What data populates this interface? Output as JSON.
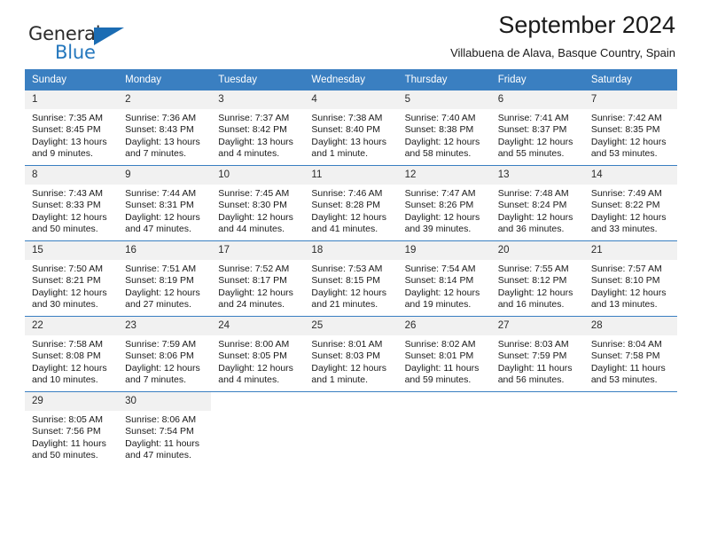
{
  "brand": {
    "name_part1": "General",
    "name_part2": "Blue",
    "triangle_color": "#1b6cb3",
    "blue_text_color": "#2477bd"
  },
  "header": {
    "month_title": "September 2024",
    "location": "Villabuena de Alava, Basque Country, Spain"
  },
  "calendar": {
    "header_bg": "#3a7fc1",
    "daynum_bg": "#f1f1f1",
    "weekdays": [
      "Sunday",
      "Monday",
      "Tuesday",
      "Wednesday",
      "Thursday",
      "Friday",
      "Saturday"
    ],
    "weeks": [
      [
        {
          "day": "1",
          "sunrise": "Sunrise: 7:35 AM",
          "sunset": "Sunset: 8:45 PM",
          "daylight": "Daylight: 13 hours and 9 minutes."
        },
        {
          "day": "2",
          "sunrise": "Sunrise: 7:36 AM",
          "sunset": "Sunset: 8:43 PM",
          "daylight": "Daylight: 13 hours and 7 minutes."
        },
        {
          "day": "3",
          "sunrise": "Sunrise: 7:37 AM",
          "sunset": "Sunset: 8:42 PM",
          "daylight": "Daylight: 13 hours and 4 minutes."
        },
        {
          "day": "4",
          "sunrise": "Sunrise: 7:38 AM",
          "sunset": "Sunset: 8:40 PM",
          "daylight": "Daylight: 13 hours and 1 minute."
        },
        {
          "day": "5",
          "sunrise": "Sunrise: 7:40 AM",
          "sunset": "Sunset: 8:38 PM",
          "daylight": "Daylight: 12 hours and 58 minutes."
        },
        {
          "day": "6",
          "sunrise": "Sunrise: 7:41 AM",
          "sunset": "Sunset: 8:37 PM",
          "daylight": "Daylight: 12 hours and 55 minutes."
        },
        {
          "day": "7",
          "sunrise": "Sunrise: 7:42 AM",
          "sunset": "Sunset: 8:35 PM",
          "daylight": "Daylight: 12 hours and 53 minutes."
        }
      ],
      [
        {
          "day": "8",
          "sunrise": "Sunrise: 7:43 AM",
          "sunset": "Sunset: 8:33 PM",
          "daylight": "Daylight: 12 hours and 50 minutes."
        },
        {
          "day": "9",
          "sunrise": "Sunrise: 7:44 AM",
          "sunset": "Sunset: 8:31 PM",
          "daylight": "Daylight: 12 hours and 47 minutes."
        },
        {
          "day": "10",
          "sunrise": "Sunrise: 7:45 AM",
          "sunset": "Sunset: 8:30 PM",
          "daylight": "Daylight: 12 hours and 44 minutes."
        },
        {
          "day": "11",
          "sunrise": "Sunrise: 7:46 AM",
          "sunset": "Sunset: 8:28 PM",
          "daylight": "Daylight: 12 hours and 41 minutes."
        },
        {
          "day": "12",
          "sunrise": "Sunrise: 7:47 AM",
          "sunset": "Sunset: 8:26 PM",
          "daylight": "Daylight: 12 hours and 39 minutes."
        },
        {
          "day": "13",
          "sunrise": "Sunrise: 7:48 AM",
          "sunset": "Sunset: 8:24 PM",
          "daylight": "Daylight: 12 hours and 36 minutes."
        },
        {
          "day": "14",
          "sunrise": "Sunrise: 7:49 AM",
          "sunset": "Sunset: 8:22 PM",
          "daylight": "Daylight: 12 hours and 33 minutes."
        }
      ],
      [
        {
          "day": "15",
          "sunrise": "Sunrise: 7:50 AM",
          "sunset": "Sunset: 8:21 PM",
          "daylight": "Daylight: 12 hours and 30 minutes."
        },
        {
          "day": "16",
          "sunrise": "Sunrise: 7:51 AM",
          "sunset": "Sunset: 8:19 PM",
          "daylight": "Daylight: 12 hours and 27 minutes."
        },
        {
          "day": "17",
          "sunrise": "Sunrise: 7:52 AM",
          "sunset": "Sunset: 8:17 PM",
          "daylight": "Daylight: 12 hours and 24 minutes."
        },
        {
          "day": "18",
          "sunrise": "Sunrise: 7:53 AM",
          "sunset": "Sunset: 8:15 PM",
          "daylight": "Daylight: 12 hours and 21 minutes."
        },
        {
          "day": "19",
          "sunrise": "Sunrise: 7:54 AM",
          "sunset": "Sunset: 8:14 PM",
          "daylight": "Daylight: 12 hours and 19 minutes."
        },
        {
          "day": "20",
          "sunrise": "Sunrise: 7:55 AM",
          "sunset": "Sunset: 8:12 PM",
          "daylight": "Daylight: 12 hours and 16 minutes."
        },
        {
          "day": "21",
          "sunrise": "Sunrise: 7:57 AM",
          "sunset": "Sunset: 8:10 PM",
          "daylight": "Daylight: 12 hours and 13 minutes."
        }
      ],
      [
        {
          "day": "22",
          "sunrise": "Sunrise: 7:58 AM",
          "sunset": "Sunset: 8:08 PM",
          "daylight": "Daylight: 12 hours and 10 minutes."
        },
        {
          "day": "23",
          "sunrise": "Sunrise: 7:59 AM",
          "sunset": "Sunset: 8:06 PM",
          "daylight": "Daylight: 12 hours and 7 minutes."
        },
        {
          "day": "24",
          "sunrise": "Sunrise: 8:00 AM",
          "sunset": "Sunset: 8:05 PM",
          "daylight": "Daylight: 12 hours and 4 minutes."
        },
        {
          "day": "25",
          "sunrise": "Sunrise: 8:01 AM",
          "sunset": "Sunset: 8:03 PM",
          "daylight": "Daylight: 12 hours and 1 minute."
        },
        {
          "day": "26",
          "sunrise": "Sunrise: 8:02 AM",
          "sunset": "Sunset: 8:01 PM",
          "daylight": "Daylight: 11 hours and 59 minutes."
        },
        {
          "day": "27",
          "sunrise": "Sunrise: 8:03 AM",
          "sunset": "Sunset: 7:59 PM",
          "daylight": "Daylight: 11 hours and 56 minutes."
        },
        {
          "day": "28",
          "sunrise": "Sunrise: 8:04 AM",
          "sunset": "Sunset: 7:58 PM",
          "daylight": "Daylight: 11 hours and 53 minutes."
        }
      ],
      [
        {
          "day": "29",
          "sunrise": "Sunrise: 8:05 AM",
          "sunset": "Sunset: 7:56 PM",
          "daylight": "Daylight: 11 hours and 50 minutes."
        },
        {
          "day": "30",
          "sunrise": "Sunrise: 8:06 AM",
          "sunset": "Sunset: 7:54 PM",
          "daylight": "Daylight: 11 hours and 47 minutes."
        },
        {
          "day": "",
          "sunrise": "",
          "sunset": "",
          "daylight": ""
        },
        {
          "day": "",
          "sunrise": "",
          "sunset": "",
          "daylight": ""
        },
        {
          "day": "",
          "sunrise": "",
          "sunset": "",
          "daylight": ""
        },
        {
          "day": "",
          "sunrise": "",
          "sunset": "",
          "daylight": ""
        },
        {
          "day": "",
          "sunrise": "",
          "sunset": "",
          "daylight": ""
        }
      ]
    ]
  }
}
